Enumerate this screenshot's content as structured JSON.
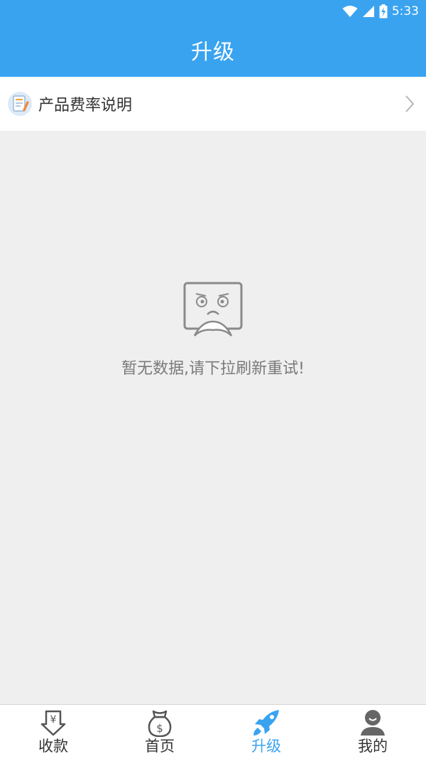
{
  "status_bar": {
    "time": "5:33"
  },
  "app_bar": {
    "title": "升级"
  },
  "rate_row": {
    "label": "产品费率说明"
  },
  "empty_state": {
    "message": "暂无数据,请下拉刷新重试!"
  },
  "tabs": [
    {
      "label": "收款",
      "icon": "yen-receive-icon",
      "active": false
    },
    {
      "label": "首页",
      "icon": "money-bag-icon",
      "active": false
    },
    {
      "label": "升级",
      "icon": "rocket-icon",
      "active": true
    },
    {
      "label": "我的",
      "icon": "user-icon",
      "active": false
    }
  ],
  "colors": {
    "primary": "#3aa3f0",
    "background": "#efefef"
  }
}
